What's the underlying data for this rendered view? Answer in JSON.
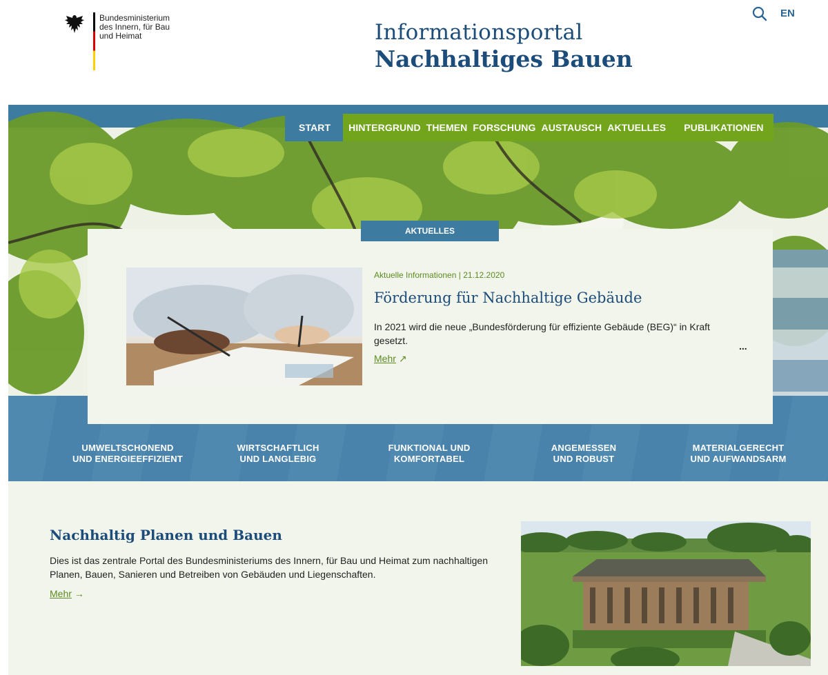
{
  "header": {
    "ministry_lines": [
      "Bundesministerium",
      "des Innern, für Bau",
      "und Heimat"
    ],
    "portal_title_line1": "Informationsportal",
    "portal_title_line2": "Nachhaltiges Bauen",
    "search_icon": "search-icon",
    "language_label": "EN"
  },
  "nav": {
    "items": [
      "START",
      "HINTERGRUND",
      "THEMEN",
      "FORSCHUNG",
      "AUSTAUSCH",
      "AKTUELLES",
      "PUBLIKATIONEN"
    ],
    "active": "START"
  },
  "news": {
    "tab_label": "AKTUELLES",
    "meta": "Aktuelle Informationen | 21.12.2020",
    "title": "Förderung für Nachhaltige Gebäude",
    "text": "In 2021 wird die neue „Bundesförderung für effiziente Gebäude (BEG)“ in Kraft gesetzt.",
    "ellipsis": "...",
    "more_label": "Mehr",
    "more_icon": "arrow-up-right-icon"
  },
  "principles": [
    {
      "line1": "UMWELTSCHONEND",
      "line2": "UND ENERGIEEFFIZIENT"
    },
    {
      "line1": "WIRTSCHAFTLICH",
      "line2": "UND LANGLEBIG"
    },
    {
      "line1": "FUNKTIONAL UND",
      "line2": "KOMFORTABEL"
    },
    {
      "line1": "ANGEMESSEN",
      "line2": "UND ROBUST"
    },
    {
      "line1": "MATERIALGERECHT",
      "line2": "UND AUFWANDSARM"
    }
  ],
  "intro": {
    "title": "Nachhaltig Planen und Bauen",
    "text": "Dies ist das zentrale Portal des Bundesministeriums des Innern, für Bau und Heimat zum nachhaltigen Planen, Bauen, Sanieren und Betreiben von Gebäuden und Liegenschaften.",
    "more_label": "Mehr",
    "more_icon": "arrow-right-icon"
  },
  "colors": {
    "primary_blue": "#1c4c79",
    "nav_blue": "#3d7ca0",
    "nav_green": "#72a51c",
    "link_green": "#5c8b1f",
    "section_bg": "#f2f5ec"
  }
}
